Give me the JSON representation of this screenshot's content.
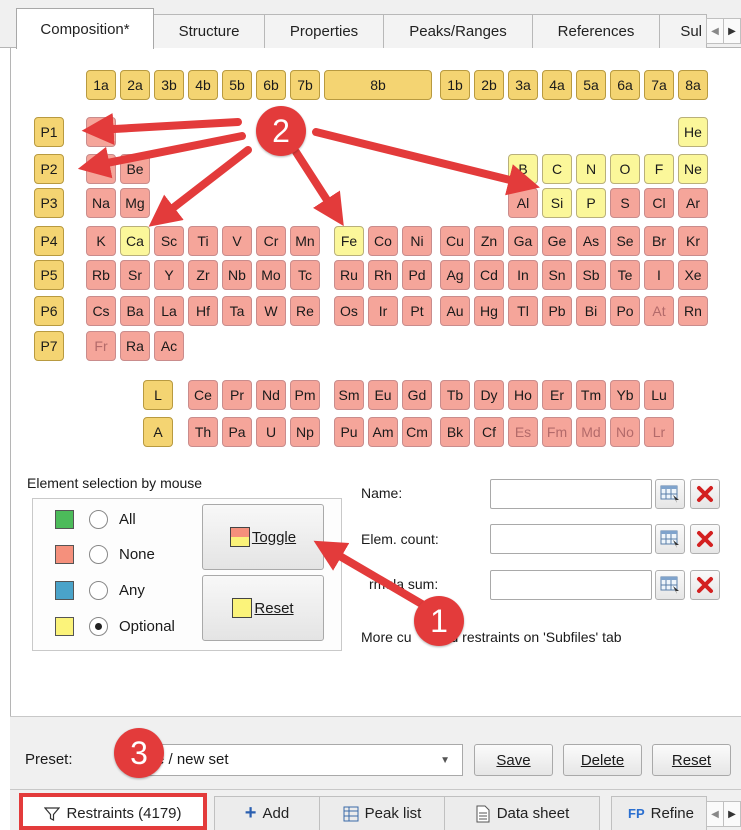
{
  "tabs": [
    {
      "label": "Composition*",
      "active": true
    },
    {
      "label": "Structure"
    },
    {
      "label": "Properties"
    },
    {
      "label": "Peaks/Ranges"
    },
    {
      "label": "References"
    },
    {
      "label": "Sul"
    }
  ],
  "groups": [
    "1a",
    "2a",
    "3b",
    "4b",
    "5b",
    "6b",
    "7b",
    "8b",
    "1b",
    "2b",
    "3a",
    "4a",
    "5a",
    "6a",
    "7a",
    "8a"
  ],
  "periods": [
    "P1",
    "P2",
    "P3",
    "P4",
    "P5",
    "P6",
    "P7"
  ],
  "series_labels": [
    "L",
    "A"
  ],
  "elements": {
    "p1": [
      "H",
      "He"
    ],
    "p2": [
      "Li",
      "Be",
      "B",
      "C",
      "N",
      "O",
      "F",
      "Ne"
    ],
    "p3": [
      "Na",
      "Mg",
      "Al",
      "Si",
      "P",
      "S",
      "Cl",
      "Ar"
    ],
    "p4": [
      "K",
      "Ca",
      "Sc",
      "Ti",
      "V",
      "Cr",
      "Mn",
      "Fe",
      "Co",
      "Ni",
      "Cu",
      "Zn",
      "Ga",
      "Ge",
      "As",
      "Se",
      "Br",
      "Kr"
    ],
    "p5": [
      "Rb",
      "Sr",
      "Y",
      "Zr",
      "Nb",
      "Mo",
      "Tc",
      "Ru",
      "Rh",
      "Pd",
      "Ag",
      "Cd",
      "In",
      "Sn",
      "Sb",
      "Te",
      "I",
      "Xe"
    ],
    "p6": [
      "Cs",
      "Ba",
      "La",
      "Hf",
      "Ta",
      "W",
      "Re",
      "Os",
      "Ir",
      "Pt",
      "Au",
      "Hg",
      "Tl",
      "Pb",
      "Bi",
      "Po",
      "At",
      "Rn"
    ],
    "p7": [
      "Fr",
      "Ra",
      "Ac"
    ],
    "lanthanides": [
      "Ce",
      "Pr",
      "Nd",
      "Pm",
      "Sm",
      "Eu",
      "Gd",
      "Tb",
      "Dy",
      "Ho",
      "Er",
      "Tm",
      "Yb",
      "Lu"
    ],
    "actinides": [
      "Th",
      "Pa",
      "U",
      "Np",
      "Pu",
      "Am",
      "Cm",
      "Bk",
      "Cf",
      "Es",
      "Fm",
      "Md",
      "No",
      "Lr"
    ]
  },
  "selection": {
    "label": "Element selection by mouse",
    "options": [
      {
        "label": "All",
        "color": "#4cbb5a"
      },
      {
        "label": "None",
        "color": "#f5907c"
      },
      {
        "label": "Any",
        "color": "#4aa3c9"
      },
      {
        "label": "Optional",
        "color": "#fbf37a",
        "selected": true
      }
    ],
    "toggle_label": "Toggle",
    "reset_label": "Reset"
  },
  "fields": {
    "name_label": "Name:",
    "elem_count_label": "Elem. count:",
    "formula_sum_label": "rmula sum:",
    "note": "More cu      and restraints on 'Subfiles' tab"
  },
  "preset": {
    "label": "Preset:",
    "value": "e / new set",
    "save": "Save",
    "delete": "Delete",
    "reset": "Reset"
  },
  "bottom_tabs": [
    {
      "label": "Restraints (4179)",
      "active": true
    },
    {
      "label": "Add"
    },
    {
      "label": "Peak list"
    },
    {
      "label": "Data sheet"
    },
    {
      "label": "Refine"
    }
  ],
  "annotations": [
    "1",
    "2",
    "3"
  ],
  "colors": {
    "callout": "#e33b3b",
    "excluded": "#f5a59a",
    "optional": "#fbf79a",
    "header": "#f4d472"
  }
}
